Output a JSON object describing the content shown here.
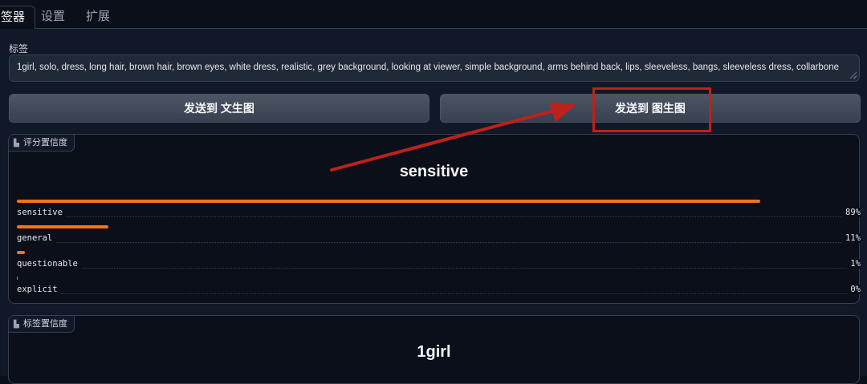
{
  "tabs": [
    {
      "label": "签器",
      "active": true
    },
    {
      "label": "设置",
      "active": false
    },
    {
      "label": "扩展",
      "active": false
    }
  ],
  "tags_field": {
    "label": "标签",
    "value": "1girl, solo, dress, long hair, brown hair, brown eyes, white dress, realistic, grey background, looking at viewer, simple background, arms behind back, lips, sleeveless, bangs, sleeveless dress, collarbone"
  },
  "buttons": {
    "send_txt2img": "发送到 文生图",
    "send_img2img": "发送到 图生图"
  },
  "rating_block": {
    "label": "评分置信度",
    "top_label": "sensitive",
    "confidences": [
      {
        "name": "sensitive",
        "percent": "89%",
        "fraction": 0.89
      },
      {
        "name": "general",
        "percent": "11%",
        "fraction": 0.11
      },
      {
        "name": "questionable",
        "percent": "1%",
        "fraction": 0.01
      },
      {
        "name": "explicit",
        "percent": "0%",
        "fraction": 0.0
      }
    ]
  },
  "tag_block": {
    "label": "标签置信度",
    "top_label": "1girl"
  },
  "colors": {
    "accent_bar": "#f97316",
    "annotation_red": "#c0201b"
  }
}
